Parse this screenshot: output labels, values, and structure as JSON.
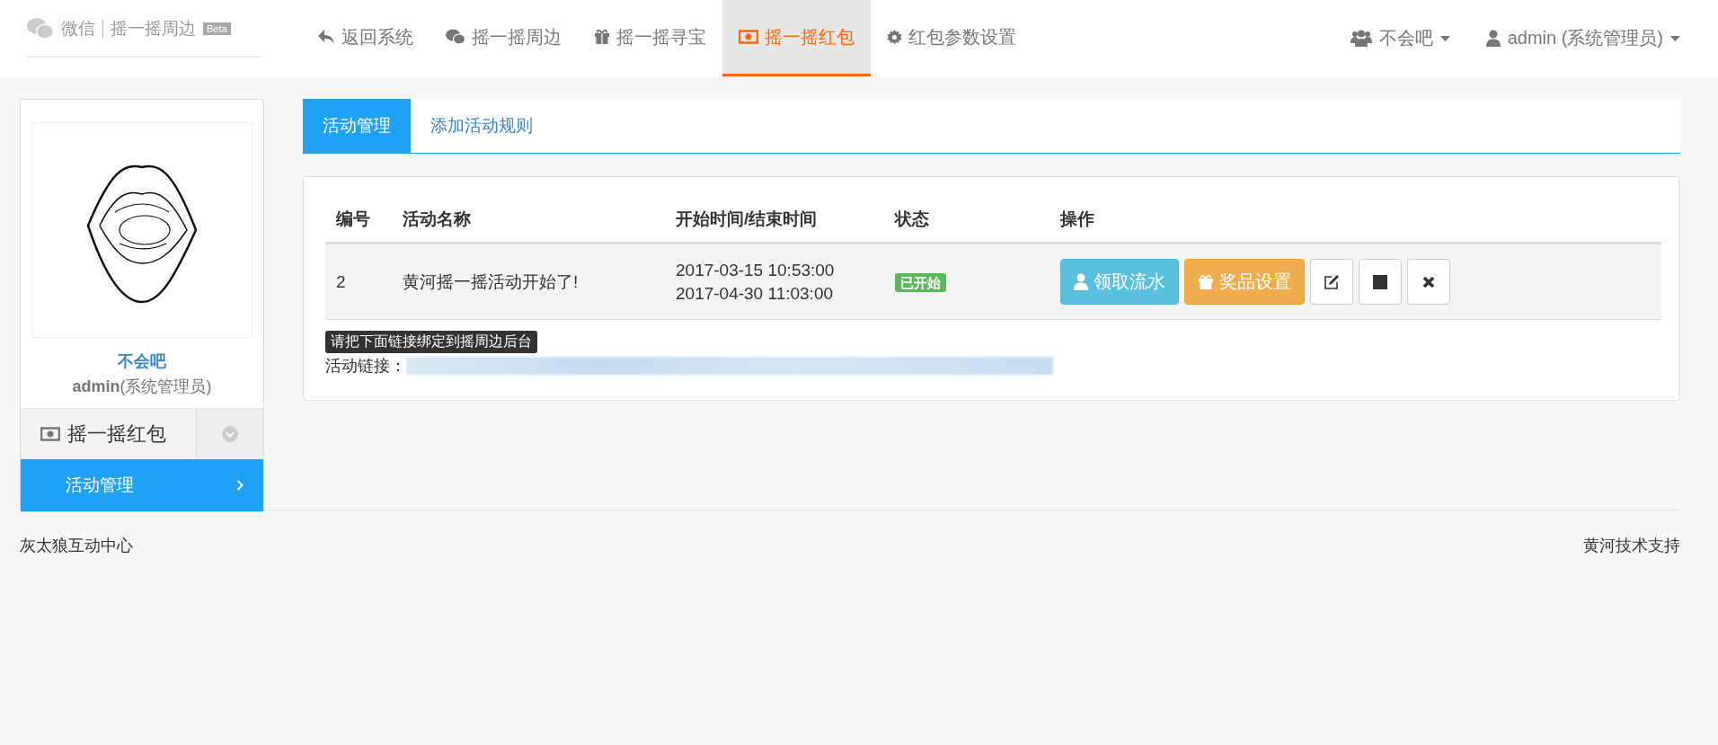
{
  "brand": {
    "name": "微信",
    "product": "摇一摇周边",
    "badge": "Beta"
  },
  "nav": [
    {
      "label": "返回系统",
      "selected": false
    },
    {
      "label": "摇一摇周边",
      "selected": false
    },
    {
      "label": "摇一摇寻宝",
      "selected": false
    },
    {
      "label": "摇一摇红包",
      "selected": true
    },
    {
      "label": "红包参数设置",
      "selected": false
    }
  ],
  "user_menu": [
    {
      "label": "不会吧"
    },
    {
      "label": "admin (系统管理员)"
    }
  ],
  "profile": {
    "name": "不会吧",
    "role": "**admin**(系统管理员)"
  },
  "sidebar": {
    "group": "摇一摇红包",
    "items": [
      {
        "label": "活动管理",
        "selected": true
      }
    ]
  },
  "tabs": [
    {
      "label": "活动管理",
      "selected": true
    },
    {
      "label": "添加活动规则",
      "selected": false
    }
  ],
  "table": {
    "columns": [
      "编号",
      "活动名称",
      "开始时间/结束时间",
      "状态",
      "操作"
    ],
    "rows": [
      {
        "id": "2",
        "name": "黄河摇一摇活动开始了!",
        "start": "2017-03-15 10:53:00",
        "end": "2017-04-30 11:03:00",
        "status": "已开始",
        "actions": [
          {
            "kind": "records",
            "label": "领取流水"
          },
          {
            "kind": "prizes",
            "label": "奖品设置"
          },
          {
            "kind": "edit"
          },
          {
            "kind": "stop"
          },
          {
            "kind": "delete"
          }
        ]
      }
    ]
  },
  "link_hint": "请把下面链接绑定到摇周边后台",
  "link_label": "活动链接：",
  "footer": {
    "left": "灰太狼互动中心",
    "right": "黄河技术支持"
  }
}
